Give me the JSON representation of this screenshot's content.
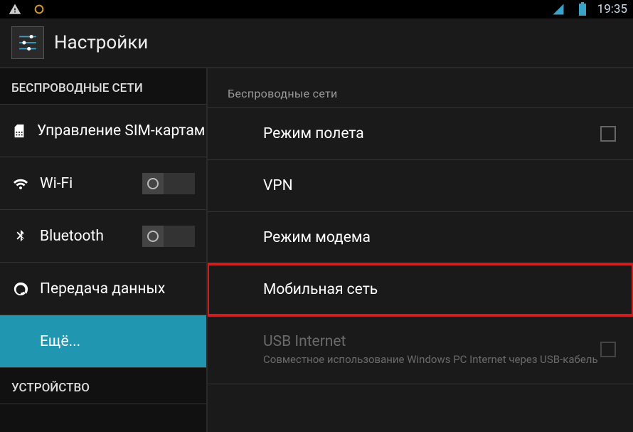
{
  "statusbar": {
    "time": "19:35",
    "icons": {
      "warning": "warning-icon",
      "circle": "circle-icon",
      "signal": "signal-icon",
      "battery": "battery-icon"
    }
  },
  "header": {
    "title": "Настройки"
  },
  "sidebar": {
    "section_wireless": "БЕСПРОВОДНЫЕ СЕТИ",
    "items": [
      {
        "label": "Управление SIM-картам",
        "icon": "sim-icon",
        "toggle": false,
        "selected": false
      },
      {
        "label": "Wi-Fi",
        "icon": "wifi-icon",
        "toggle": true,
        "toggle_on": false,
        "selected": false
      },
      {
        "label": "Bluetooth",
        "icon": "bluetooth-icon",
        "toggle": true,
        "toggle_on": false,
        "selected": false
      },
      {
        "label": "Передача данных",
        "icon": "data-usage-icon",
        "toggle": false,
        "selected": false
      },
      {
        "label": "Ещё...",
        "icon": "",
        "toggle": false,
        "selected": true
      }
    ],
    "section_device": "УСТРОЙСТВО"
  },
  "main": {
    "section_title": "Беспроводные сети",
    "items": [
      {
        "label": "Режим полета",
        "checkbox": true,
        "checked": false,
        "disabled": false
      },
      {
        "label": "VPN",
        "checkbox": false,
        "disabled": false
      },
      {
        "label": "Режим модема",
        "checkbox": false,
        "disabled": false
      },
      {
        "label": "Мобильная сеть",
        "checkbox": false,
        "disabled": false,
        "highlighted": true
      },
      {
        "label": "USB Internet",
        "sub": "Совместное использование Windows PC Internet через USB-кабель",
        "checkbox": true,
        "checked": false,
        "disabled": true
      }
    ]
  }
}
